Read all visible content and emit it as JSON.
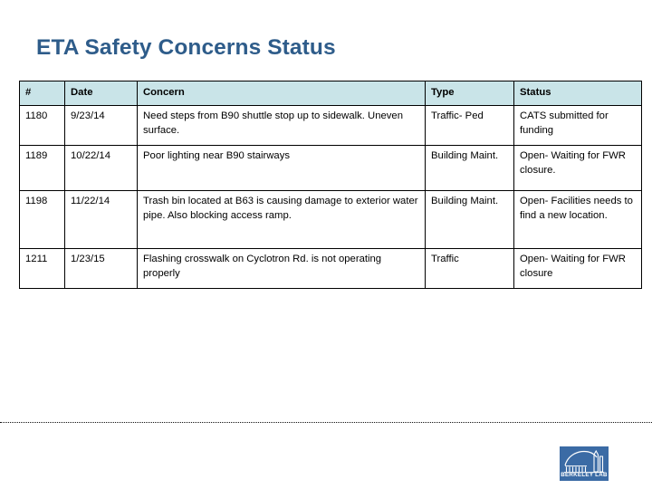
{
  "slide": {
    "title": "ETA Safety Concerns Status",
    "title_color": "#2e5c8a",
    "background_color": "#ffffff"
  },
  "table": {
    "header_background": "#c9e4e8",
    "border_color": "#000000",
    "columns": [
      {
        "key": "num",
        "label": "#"
      },
      {
        "key": "date",
        "label": "Date"
      },
      {
        "key": "concern",
        "label": "Concern"
      },
      {
        "key": "type",
        "label": "Type"
      },
      {
        "key": "status",
        "label": "Status"
      }
    ],
    "rows": [
      {
        "num": "1180",
        "date": "9/23/14",
        "concern": "Need steps from B90 shuttle stop up to sidewalk. Uneven surface.",
        "type": "Traffic- Ped",
        "status": "CATS submitted for funding"
      },
      {
        "num": "1189",
        "date": "10/22/14",
        "concern": "Poor lighting near B90 stairways",
        "type": "Building Maint.",
        "status": "Open- Waiting for FWR closure."
      },
      {
        "num": "1198",
        "date": "11/22/14",
        "concern": "Trash bin located at B63 is causing damage to exterior water pipe. Also blocking access ramp.",
        "type": "Building Maint.",
        "status": "Open- Facilities needs to find a new location."
      },
      {
        "num": "1211",
        "date": "1/23/15",
        "concern": "Flashing crosswalk on Cyclotron Rd. is not operating properly",
        "type": "Traffic",
        "status": "Open- Waiting for FWR closure"
      }
    ]
  },
  "footer": {
    "logo_text": "BERKELEY LAB",
    "logo_background": "#3b6ba5",
    "divider_style": "dotted"
  }
}
